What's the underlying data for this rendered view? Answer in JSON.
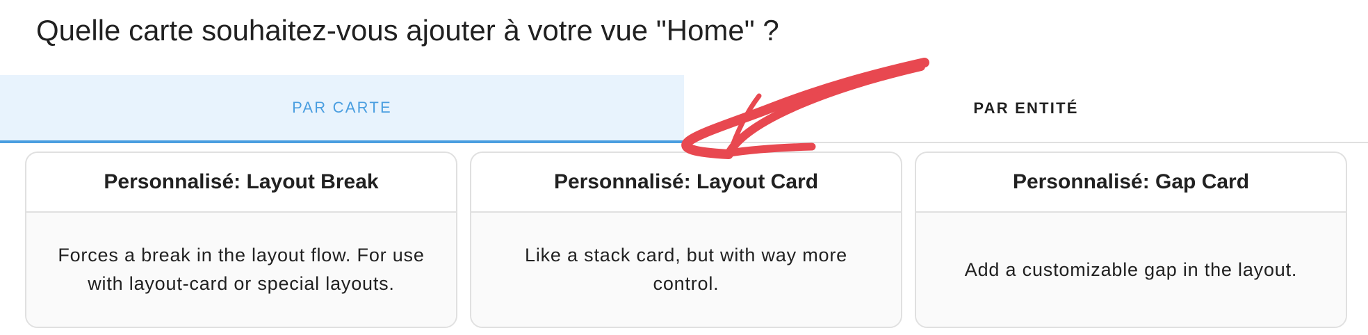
{
  "dialog": {
    "title": "Quelle carte souhaitez-vous ajouter à votre vue \"Home\" ?"
  },
  "tabs": [
    {
      "label": "PAR CARTE",
      "active": true
    },
    {
      "label": "PAR ENTITÉ",
      "active": false
    }
  ],
  "cards": [
    {
      "title": "Personnalisé: Layout Break",
      "description": "Forces a break in the layout flow. For use with layout-card or special layouts."
    },
    {
      "title": "Personnalisé: Layout Card",
      "description": "Like a stack card, but with way more control."
    },
    {
      "title": "Personnalisé: Gap Card",
      "description": "Add a customizable gap in the layout."
    }
  ],
  "colors": {
    "accent": "#4a9ee0",
    "active_tab_bg": "#e8f3fd",
    "annotation_arrow": "#e84850"
  },
  "annotation": {
    "icon": "red-arrow-icon"
  }
}
